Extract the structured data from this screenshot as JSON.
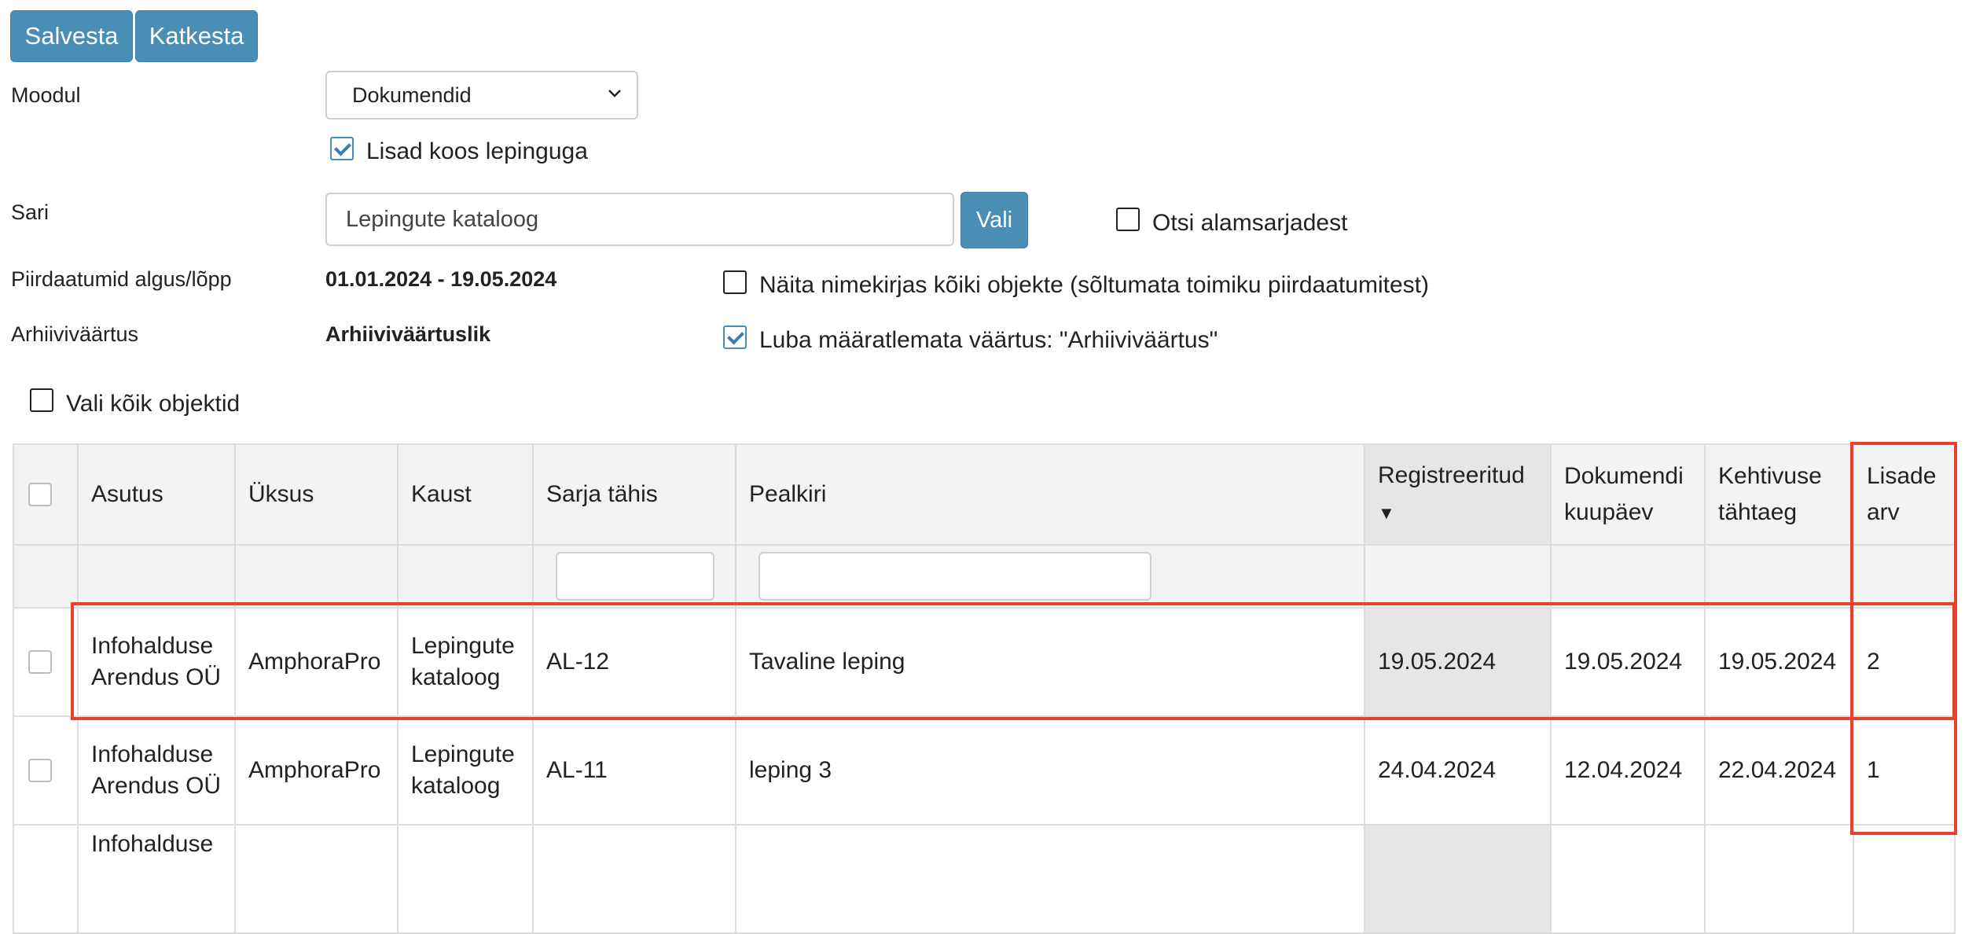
{
  "toolbar": {
    "save_label": "Salvesta",
    "cancel_label": "Katkesta"
  },
  "form": {
    "module_label": "Moodul",
    "module_value": "Dokumendid",
    "with_contract_label": "Lisad koos lepinguga",
    "with_contract_checked": true,
    "series_label": "Sari",
    "series_value": "Lepingute kataloog",
    "choose_label": "Vali",
    "search_subseries_label": "Otsi alamsarjadest",
    "search_subseries_checked": false,
    "date_range_label": "Piirdaatumid algus/lõpp",
    "date_range_value": "01.01.2024 - 19.05.2024",
    "show_all_label": "Näita nimekirjas kõiki objekte (sõltumata toimiku piirdaatumitest)",
    "show_all_checked": false,
    "archive_label": "Arhiiviväärtus",
    "archive_value": "Arhiiviväärtuslik",
    "allow_undefined_label": "Luba määratlemata väärtus: \"Arhiiviväärtus\"",
    "allow_undefined_checked": true,
    "select_all_label": "Vali kõik objektid",
    "select_all_checked": false
  },
  "table": {
    "headers": {
      "agency": "Asutus",
      "unit": "Üksus",
      "folder": "Kaust",
      "series": "Sarja tähis",
      "title": "Pealkiri",
      "registered": "Registreeritud",
      "doc_date": "Dokumendi kuupäev",
      "expiry": "Kehtivuse tähtaeg",
      "attachments": "Lisade arv"
    },
    "sort_indicator": "▼",
    "rows": [
      {
        "agency": "Infohalduse Arendus OÜ",
        "unit": "AmphoraPro",
        "folder": "Lepingute kataloog",
        "series": "AL-12",
        "title": "Tavaline leping",
        "registered": "19.05.2024",
        "doc_date": "19.05.2024",
        "expiry": "19.05.2024",
        "attachments": "2"
      },
      {
        "agency": "Infohalduse Arendus OÜ",
        "unit": "AmphoraPro",
        "folder": "Lepingute kataloog",
        "series": "AL-11",
        "title": "leping 3",
        "registered": "24.04.2024",
        "doc_date": "12.04.2024",
        "expiry": "22.04.2024",
        "attachments": "1"
      },
      {
        "agency": "Infohalduse",
        "unit": "",
        "folder": "",
        "series": "",
        "title": "",
        "registered": "",
        "doc_date": "",
        "expiry": "",
        "attachments": ""
      }
    ]
  },
  "colors": {
    "accent": "#4a8db5",
    "highlight": "#e8412e"
  }
}
